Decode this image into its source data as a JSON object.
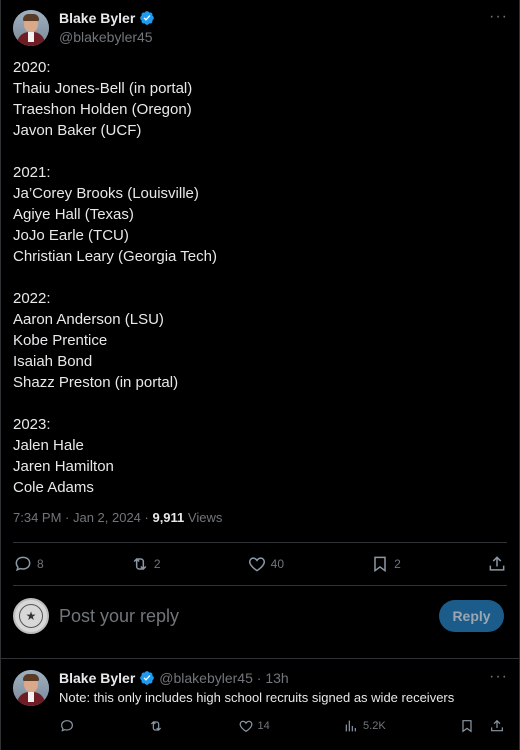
{
  "tweet": {
    "display_name": "Blake Byler",
    "handle": "@blakebyler45",
    "text": "2020:\nThaiu Jones-Bell (in portal)\nTraeshon Holden (Oregon)\nJavon Baker (UCF)\n\n2021:\nJa’Corey Brooks (Louisville)\nAgiye Hall (Texas)\nJoJo Earle (TCU)\nChristian Leary (Georgia Tech)\n\n2022:\nAaron Anderson (LSU)\nKobe Prentice\nIsaiah Bond\nShazz Preston (in portal)\n\n2023:\nJalen Hale\nJaren Hamilton\nCole Adams",
    "time": "7:34 PM · Jan 2, 2024 · ",
    "views_count": "9,911",
    "views_label": " Views",
    "actions": {
      "replies": "8",
      "reposts": "2",
      "likes": "40",
      "bookmarks": "2"
    }
  },
  "compose": {
    "placeholder": "Post your reply",
    "button_label": "Reply"
  },
  "reply": {
    "display_name": "Blake Byler",
    "handle": "@blakebyler45 · 13h",
    "text": "Note: this only includes high school recruits signed as wide receivers",
    "actions": {
      "likes": "14",
      "views": "5.2K"
    }
  },
  "colors": {
    "background": "#000000",
    "text": "#e7e9ea",
    "muted": "#71767b",
    "verified": "#1d9bf0",
    "reply_button": "#1b5c8a"
  },
  "icons": [
    "verified-badge-icon",
    "more-icon",
    "reply-icon",
    "repost-icon",
    "like-icon",
    "bookmark-icon",
    "share-icon",
    "views-icon"
  ]
}
